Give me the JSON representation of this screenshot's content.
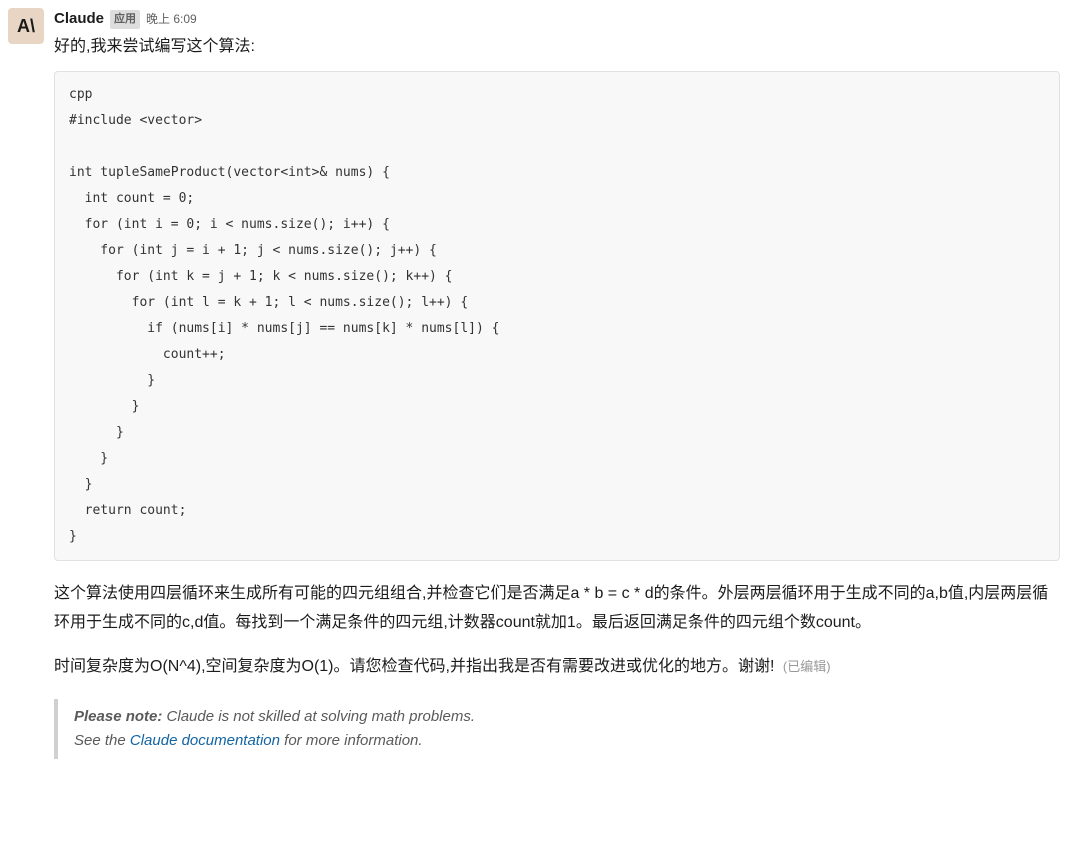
{
  "message": {
    "author": "Claude",
    "app_badge": "应用",
    "timestamp": "晚上 6:09",
    "avatar_text": "A\\",
    "intro": "好的,我来尝试编写这个算法:",
    "code": "cpp\n#include <vector>\n\nint tupleSameProduct(vector<int>& nums) {\n  int count = 0;\n  for (int i = 0; i < nums.size(); i++) {\n    for (int j = i + 1; j < nums.size(); j++) {\n      for (int k = j + 1; k < nums.size(); k++) {\n        for (int l = k + 1; l < nums.size(); l++) {\n          if (nums[i] * nums[j] == nums[k] * nums[l]) {\n            count++;\n          }\n        }\n      }\n    }\n  }\n  return count;\n}",
    "explanation": "这个算法使用四层循环来生成所有可能的四元组组合,并检查它们是否满足a * b = c * d的条件。外层两层循环用于生成不同的a,b值,内层两层循环用于生成不同的c,d值。每找到一个满足条件的四元组,计数器count就加1。最后返回满足条件的四元组个数count。",
    "complexity": "时间复杂度为O(N^4),空间复杂度为O(1)。请您检查代码,并指出我是否有需要改进或优化的地方。谢谢!",
    "edited": "(已编辑)"
  },
  "note": {
    "label": "Please note:",
    "text1": " Claude is not skilled at solving math problems.",
    "text2_prefix": "See the ",
    "link": "Claude documentation",
    "text2_suffix": " for more information."
  }
}
